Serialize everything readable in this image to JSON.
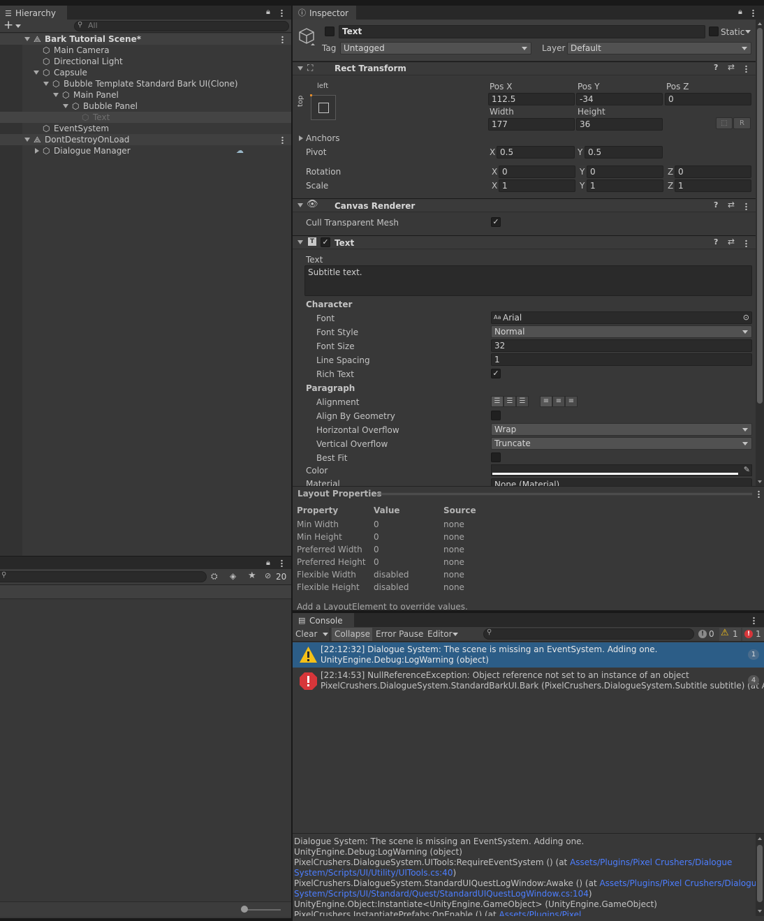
{
  "hierarchy": {
    "tab": "Hierarchy",
    "search_placeholder": "All",
    "items": [
      {
        "label": "Bark Tutorial Scene*",
        "depth": 0,
        "kind": "scene",
        "bold": true,
        "selected": false
      },
      {
        "label": "Main Camera",
        "depth": 1,
        "kind": "go"
      },
      {
        "label": "Directional Light",
        "depth": 1,
        "kind": "go"
      },
      {
        "label": "Capsule",
        "depth": 1,
        "kind": "go"
      },
      {
        "label": "Bubble Template Standard Bark UI(Clone)",
        "depth": 2,
        "kind": "go"
      },
      {
        "label": "Main Panel",
        "depth": 3,
        "kind": "go"
      },
      {
        "label": "Bubble Panel",
        "depth": 4,
        "kind": "go"
      },
      {
        "label": "Text",
        "depth": 5,
        "kind": "go",
        "dim": true,
        "selected": true
      },
      {
        "label": "EventSystem",
        "depth": 1,
        "kind": "go"
      },
      {
        "label": "DontDestroyOnLoad",
        "depth": 0,
        "kind": "scene"
      },
      {
        "label": "Dialogue Manager",
        "depth": 1,
        "kind": "go"
      }
    ]
  },
  "project": {
    "hidden_count": "20"
  },
  "inspector": {
    "tab": "Inspector",
    "object_name": "Text",
    "static_label": "Static",
    "tag_label": "Tag",
    "tag_value": "Untagged",
    "layer_label": "Layer",
    "layer_value": "Default",
    "rect_transform": {
      "title": "Rect Transform",
      "anchor_h": "left",
      "anchor_v": "top",
      "posx_label": "Pos X",
      "posx": "112.5",
      "posy_label": "Pos Y",
      "posy": "-34",
      "posz_label": "Pos Z",
      "posz": "0",
      "width_label": "Width",
      "width": "177",
      "height_label": "Height",
      "height": "36",
      "r_button": "R",
      "anchors_label": "Anchors",
      "pivot_label": "Pivot",
      "pivot_x": "0.5",
      "pivot_y": "0.5",
      "rotation_label": "Rotation",
      "rot_x": "0",
      "rot_y": "0",
      "rot_z": "0",
      "scale_label": "Scale",
      "scale_x": "1",
      "scale_y": "1",
      "scale_z": "1",
      "x": "X",
      "y": "Y",
      "z": "Z"
    },
    "canvas_renderer": {
      "title": "Canvas Renderer",
      "cull_label": "Cull Transparent Mesh",
      "cull_checked": true
    },
    "text_component": {
      "title": "Text",
      "text_label": "Text",
      "text_value": "Subtitle text.",
      "character_label": "Character",
      "font_label": "Font",
      "font_value": "Arial",
      "font_style_label": "Font Style",
      "font_style_value": "Normal",
      "font_size_label": "Font Size",
      "font_size_value": "32",
      "line_spacing_label": "Line Spacing",
      "line_spacing_value": "1",
      "rich_text_label": "Rich Text",
      "rich_text_checked": true,
      "paragraph_label": "Paragraph",
      "alignment_label": "Alignment",
      "align_geometry_label": "Align By Geometry",
      "h_overflow_label": "Horizontal Overflow",
      "h_overflow_value": "Wrap",
      "v_overflow_label": "Vertical Overflow",
      "v_overflow_value": "Truncate",
      "best_fit_label": "Best Fit",
      "color_label": "Color",
      "color_value": "#ffffff",
      "material_label": "Material",
      "material_value": "None (Material)"
    }
  },
  "layout_properties": {
    "title": "Layout Properties",
    "headers": [
      "Property",
      "Value",
      "Source"
    ],
    "rows": [
      [
        "Min Width",
        "0",
        "none"
      ],
      [
        "Min Height",
        "0",
        "none"
      ],
      [
        "Preferred Width",
        "0",
        "none"
      ],
      [
        "Preferred Height",
        "0",
        "none"
      ],
      [
        "Flexible Width",
        "disabled",
        "none"
      ],
      [
        "Flexible Height",
        "disabled",
        "none"
      ]
    ],
    "footer": "Add a LayoutElement to override values."
  },
  "console": {
    "tab": "Console",
    "clear": "Clear",
    "collapse": "Collapse",
    "error_pause": "Error Pause",
    "editor": "Editor",
    "log_count": "0",
    "warn_count": "1",
    "error_count": "1",
    "entries": [
      {
        "type": "warning",
        "line1": "[22:12:32] Dialogue System: The scene is missing an EventSystem. Adding one.",
        "line2": "UnityEngine.Debug:LogWarning (object)",
        "count": "1"
      },
      {
        "type": "error",
        "line1": "[22:14:53] NullReferenceException: Object reference not set to an instance of an object",
        "line2": "PixelCrushers.DialogueSystem.StandardBarkUI.Bark (PixelCrushers.DialogueSystem.Subtitle subtitle) (at Assets/P",
        "count": "4"
      }
    ],
    "detail": {
      "l1": "Dialogue System: The scene is missing an EventSystem. Adding one.",
      "l2": "UnityEngine.Debug:LogWarning (object)",
      "l3a": "PixelCrushers.DialogueSystem.UITools:RequireEventSystem () (at ",
      "l3link": "Assets/Plugins/Pixel Crushers/Dialogue",
      "l4link": "System/Scripts/UI/Utility/UITools.cs:40",
      "l4b": ")",
      "l5a": "PixelCrushers.DialogueSystem.StandardUIQuestLogWindow:Awake () (at ",
      "l5link": "Assets/Plugins/Pixel Crushers/Dialogue",
      "l6link": "System/Scripts/UI/Standard/Quest/StandardUIQuestLogWindow.cs:104",
      "l6b": ")",
      "l7": "UnityEngine.Object:Instantiate<UnityEngine.GameObject> (UnityEngine.GameObject)",
      "l8a": "PixelCrushers.InstantiatePrefabs:OnEnable () (at ",
      "l8link": "Assets/Plugins/Pixel"
    }
  },
  "colors": {
    "selection": "#2c5d87",
    "link": "#4c7eff",
    "warning": "#f4c018",
    "error": "#d7363a"
  }
}
